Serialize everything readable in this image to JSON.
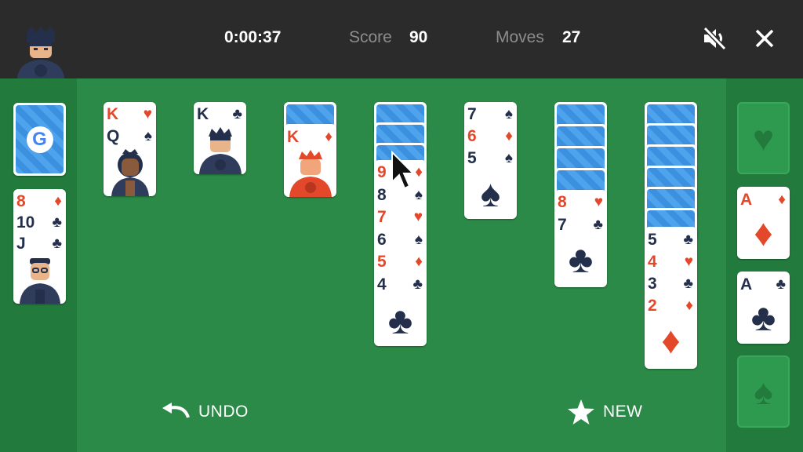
{
  "header": {
    "timer": "0:00:37",
    "score_label": "Score",
    "score_value": "90",
    "moves_label": "Moves",
    "moves_value": "27",
    "avatar_icon": "player-avatar-icon",
    "mute_icon": "volume-muted-icon",
    "close_icon": "close-icon"
  },
  "stock": {
    "logo": "G",
    "icon": "google-logo-icon"
  },
  "waste": {
    "cards": [
      {
        "rank": "8",
        "suit": "♦",
        "color": "red"
      },
      {
        "rank": "10",
        "suit": "♣",
        "color": "black"
      },
      {
        "rank": "J",
        "suit": "♣",
        "color": "black"
      }
    ]
  },
  "tableau": [
    {
      "cards": [
        {
          "rank": "K",
          "suit": "♥",
          "color": "red"
        },
        {
          "rank": "Q",
          "suit": "♠",
          "color": "black"
        }
      ]
    },
    {
      "cards": [
        {
          "rank": "K",
          "suit": "♣",
          "color": "black"
        }
      ]
    },
    {
      "cards": [
        {
          "rank": "K",
          "suit": "♦",
          "color": "red"
        }
      ],
      "hidden": 1
    },
    {
      "cards": [
        {
          "rank": "9",
          "suit": "♦",
          "color": "red"
        },
        {
          "rank": "8",
          "suit": "♠",
          "color": "black"
        },
        {
          "rank": "7",
          "suit": "♥",
          "color": "red"
        },
        {
          "rank": "6",
          "suit": "♠",
          "color": "black"
        },
        {
          "rank": "5",
          "suit": "♦",
          "color": "red"
        },
        {
          "rank": "4",
          "suit": "♣",
          "color": "black"
        }
      ],
      "hidden": 3
    },
    {
      "cards": [
        {
          "rank": "7",
          "suit": "♠",
          "color": "black"
        },
        {
          "rank": "6",
          "suit": "♦",
          "color": "red"
        },
        {
          "rank": "5",
          "suit": "♠",
          "color": "black"
        }
      ]
    },
    {
      "cards": [
        {
          "rank": "8",
          "suit": "♥",
          "color": "red"
        },
        {
          "rank": "7",
          "suit": "♣",
          "color": "black"
        }
      ],
      "hidden": 4
    },
    {
      "cards": [
        {
          "rank": "5",
          "suit": "♣",
          "color": "black"
        },
        {
          "rank": "4",
          "suit": "♥",
          "color": "red"
        },
        {
          "rank": "3",
          "suit": "♣",
          "color": "black"
        },
        {
          "rank": "2",
          "suit": "♦",
          "color": "red"
        }
      ],
      "hidden": 6
    }
  ],
  "foundations": [
    {
      "empty": true,
      "suit": "♥",
      "icon": "heart-placeholder-icon"
    },
    {
      "rank": "A",
      "suit": "♦",
      "color": "red"
    },
    {
      "rank": "A",
      "suit": "♣",
      "color": "black"
    },
    {
      "empty": true,
      "suit": "♠",
      "icon": "spade-placeholder-icon"
    }
  ],
  "actions": {
    "undo_label": "UNDO",
    "new_label": "NEW",
    "undo_icon": "undo-arrow-icon",
    "new_icon": "star-icon"
  },
  "colors": {
    "felt": "#2b8a47",
    "rail": "#237a3d",
    "topbar": "#2b2b2b",
    "red_suit": "#e4482b",
    "black_suit": "#24304b",
    "card_back": "#4fa3ec"
  }
}
